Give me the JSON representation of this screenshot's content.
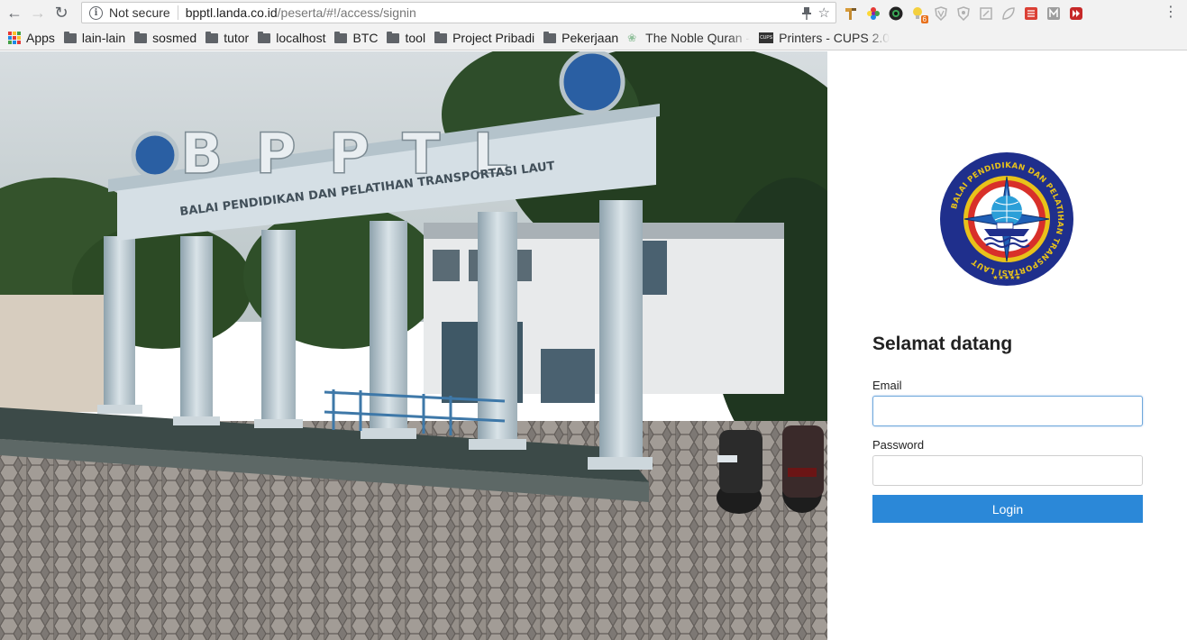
{
  "browser": {
    "security_label": "Not secure",
    "url_host": "bpptl.landa.co.id",
    "url_path": "/peserta/#!/access/signin",
    "extension_badge": "6"
  },
  "bookmarks": [
    {
      "label": "Apps",
      "icon": "apps-icon"
    },
    {
      "label": "lain-lain",
      "icon": "folder-icon"
    },
    {
      "label": "sosmed",
      "icon": "folder-icon"
    },
    {
      "label": "tutor",
      "icon": "folder-icon"
    },
    {
      "label": "localhost",
      "icon": "folder-icon"
    },
    {
      "label": "BTC",
      "icon": "folder-icon"
    },
    {
      "label": "tool",
      "icon": "folder-icon"
    },
    {
      "label": "Project Pribadi",
      "icon": "folder-icon"
    },
    {
      "label": "Pekerjaan",
      "icon": "folder-icon"
    },
    {
      "label": "The Noble Quran -",
      "icon": "quran-icon"
    },
    {
      "label": "Printers - CUPS 2.0",
      "icon": "cups-icon"
    }
  ],
  "hero": {
    "sign_letters": "BPPTL",
    "sign_subtitle": "BALAI PENDIDIKAN DAN PELATIHAN TRANSPORTASI LAUT"
  },
  "login": {
    "logo_text": "BALAI PENDIDIKAN DAN PELATIHAN TRANSPORTASI LAUT",
    "title": "Selamat datang",
    "email_label": "Email",
    "email_value": "",
    "password_label": "Password",
    "password_value": "",
    "button_label": "Login"
  },
  "colors": {
    "primary": "#2b88d8",
    "logo_navy": "#1f2f8c",
    "logo_gold": "#e8c21a",
    "logo_red": "#d8302a"
  }
}
